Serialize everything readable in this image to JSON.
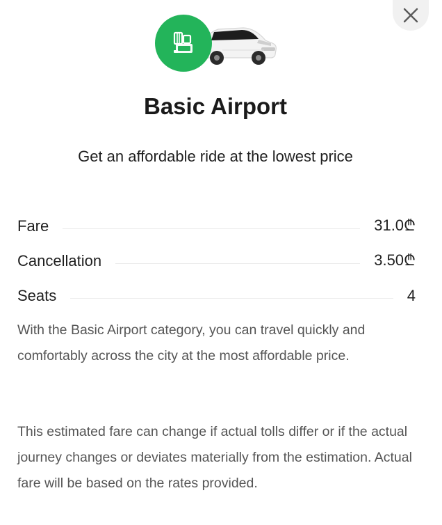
{
  "header": {
    "badge_icon": "luggage-icon",
    "vehicle_icon": "car-icon",
    "close_icon": "close-icon",
    "accent_color": "#23b45a"
  },
  "title": "Basic Airport",
  "subtitle": "Get an affordable ride at the lowest price",
  "details": [
    {
      "label": "Fare",
      "value": "31.0₾"
    },
    {
      "label": "Cancellation",
      "value": "3.50₾"
    },
    {
      "label": "Seats",
      "value": "4"
    }
  ],
  "description": "With the Basic Airport category, you can travel quickly and comfortably across the city at the most affordable price.",
  "disclaimer": "This estimated fare can change if actual tolls differ or if the actual journey changes or deviates materially from the estimation. Actual fare will be based on the rates provided."
}
